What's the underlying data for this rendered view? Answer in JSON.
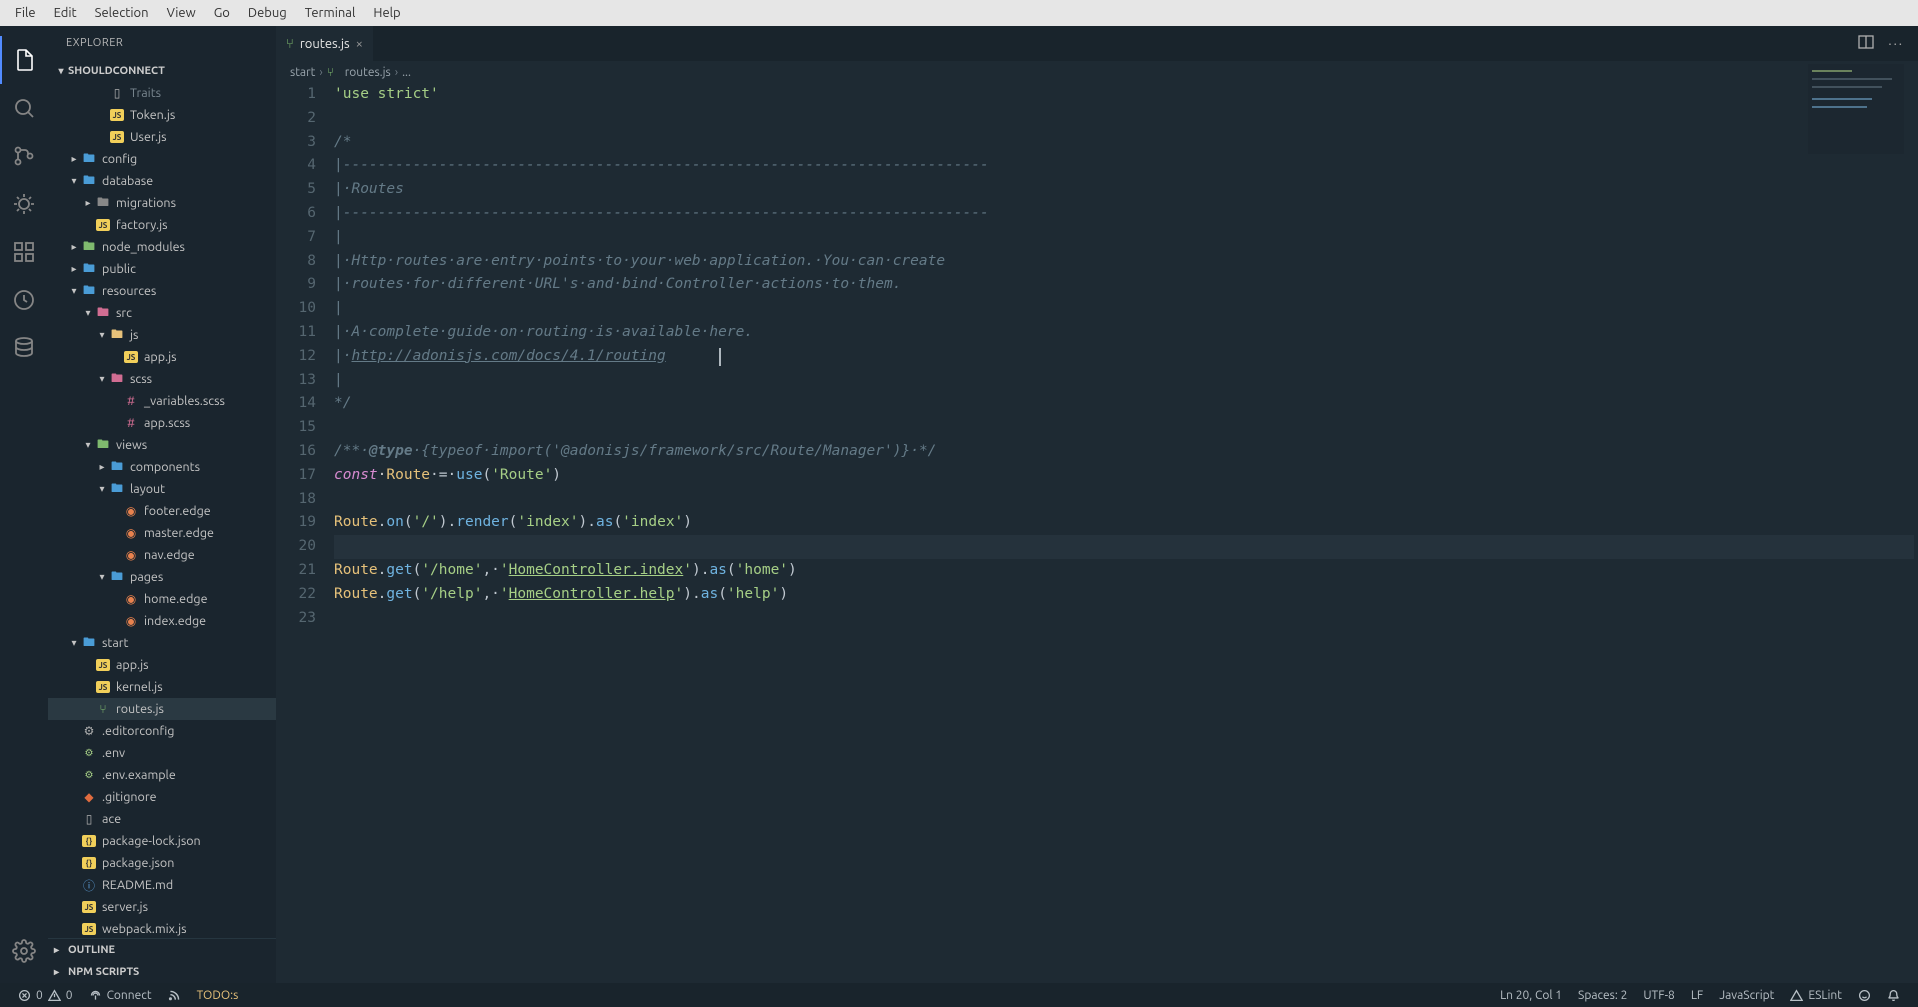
{
  "menubar": [
    "File",
    "Edit",
    "Selection",
    "View",
    "Go",
    "Debug",
    "Terminal",
    "Help"
  ],
  "activitybar": {
    "items": [
      {
        "name": "explorer-icon"
      },
      {
        "name": "search-icon"
      },
      {
        "name": "source-control-icon"
      },
      {
        "name": "debug-icon"
      },
      {
        "name": "extensions-icon"
      },
      {
        "name": "clock-icon"
      },
      {
        "name": "database-icon"
      }
    ],
    "bottom": {
      "name": "settings-gear-icon"
    }
  },
  "sidebar": {
    "header": "EXPLORER",
    "project": "SHOULDCONNECT",
    "tree": [
      {
        "indent": 3,
        "type": "file",
        "icon": "plain",
        "name": "Traits",
        "dim": true
      },
      {
        "indent": 3,
        "type": "file",
        "icon": "js",
        "name": "Token.js"
      },
      {
        "indent": 3,
        "type": "file",
        "icon": "js",
        "name": "User.js"
      },
      {
        "indent": 1,
        "type": "folder-closed",
        "icon": "folder",
        "name": "config"
      },
      {
        "indent": 1,
        "type": "folder-open",
        "icon": "folder",
        "name": "database"
      },
      {
        "indent": 2,
        "type": "folder-closed",
        "icon": "folder-dim",
        "name": "migrations"
      },
      {
        "indent": 2,
        "type": "file",
        "icon": "js",
        "name": "factory.js"
      },
      {
        "indent": 1,
        "type": "folder-closed",
        "icon": "folder-green",
        "name": "node_modules"
      },
      {
        "indent": 1,
        "type": "folder-closed",
        "icon": "folder",
        "name": "public"
      },
      {
        "indent": 1,
        "type": "folder-open",
        "icon": "folder",
        "name": "resources"
      },
      {
        "indent": 2,
        "type": "folder-open",
        "icon": "folder-pink",
        "name": "src"
      },
      {
        "indent": 3,
        "type": "folder-open",
        "icon": "folder-js",
        "name": "js"
      },
      {
        "indent": 4,
        "type": "file",
        "icon": "js",
        "name": "app.js"
      },
      {
        "indent": 3,
        "type": "folder-open",
        "icon": "folder-pink",
        "name": "scss"
      },
      {
        "indent": 4,
        "type": "file",
        "icon": "scss",
        "name": "_variables.scss"
      },
      {
        "indent": 4,
        "type": "file",
        "icon": "scss",
        "name": "app.scss"
      },
      {
        "indent": 2,
        "type": "folder-open",
        "icon": "folder-green",
        "name": "views"
      },
      {
        "indent": 3,
        "type": "folder-closed",
        "icon": "folder",
        "name": "components"
      },
      {
        "indent": 3,
        "type": "folder-open",
        "icon": "folder",
        "name": "layout"
      },
      {
        "indent": 4,
        "type": "file",
        "icon": "edge",
        "name": "footer.edge"
      },
      {
        "indent": 4,
        "type": "file",
        "icon": "edge",
        "name": "master.edge"
      },
      {
        "indent": 4,
        "type": "file",
        "icon": "edge",
        "name": "nav.edge"
      },
      {
        "indent": 3,
        "type": "folder-open",
        "icon": "folder",
        "name": "pages"
      },
      {
        "indent": 4,
        "type": "file",
        "icon": "edge",
        "name": "home.edge"
      },
      {
        "indent": 4,
        "type": "file",
        "icon": "edge",
        "name": "index.edge"
      },
      {
        "indent": 1,
        "type": "folder-open",
        "icon": "folder",
        "name": "start"
      },
      {
        "indent": 2,
        "type": "file",
        "icon": "js",
        "name": "app.js"
      },
      {
        "indent": 2,
        "type": "file",
        "icon": "js",
        "name": "kernel.js"
      },
      {
        "indent": 2,
        "type": "file",
        "icon": "route",
        "name": "routes.js",
        "selected": true
      },
      {
        "indent": 1,
        "type": "file",
        "icon": "config",
        "name": ".editorconfig"
      },
      {
        "indent": 1,
        "type": "file",
        "icon": "env",
        "name": ".env"
      },
      {
        "indent": 1,
        "type": "file",
        "icon": "env",
        "name": ".env.example"
      },
      {
        "indent": 1,
        "type": "file",
        "icon": "git",
        "name": ".gitignore"
      },
      {
        "indent": 1,
        "type": "file",
        "icon": "plain",
        "name": "ace"
      },
      {
        "indent": 1,
        "type": "file",
        "icon": "json",
        "name": "package-lock.json"
      },
      {
        "indent": 1,
        "type": "file",
        "icon": "json",
        "name": "package.json"
      },
      {
        "indent": 1,
        "type": "file",
        "icon": "md",
        "name": "README.md"
      },
      {
        "indent": 1,
        "type": "file",
        "icon": "js",
        "name": "server.js"
      },
      {
        "indent": 1,
        "type": "file",
        "icon": "js",
        "name": "webpack.mix.js"
      }
    ],
    "bottom_sections": [
      "OUTLINE",
      "NPM SCRIPTS"
    ]
  },
  "tab": {
    "icon": "route",
    "label": "routes.js"
  },
  "breadcrumbs": [
    "start",
    "routes.js",
    "..."
  ],
  "editor": {
    "highlight_line": 20,
    "lines": 23,
    "code": {
      "l1": "'use strict'",
      "l3": "/*",
      "l4": "|--------------------------------------------------------------------------",
      "l5": "|·Routes",
      "l6": "|--------------------------------------------------------------------------",
      "l7": "|",
      "l8": "|·Http·routes·are·entry·points·to·your·web·application.·You·can·create",
      "l9": "|·routes·for·different·URL's·and·bind·Controller·actions·to·them.",
      "l10": "|",
      "l11": "|·A·complete·guide·on·routing·is·available·here.",
      "l12_pre": "|·",
      "l12_link": "http://adonisjs.com/docs/4.1/routing",
      "l13": "|",
      "l14": "*/",
      "l16_pre": "/**·",
      "l16_tag": "@type",
      "l16_mid": "·{typeof·",
      "l16_imp": "import",
      "l16_paren": "(",
      "l16_str": "'@adonisjs/framework/src/Route/Manager'",
      "l16_close": ")}",
      "l16_end": "·*/",
      "l17_const": "const",
      "l17_sp": "·",
      "l17_route": "Route",
      "l17_eq": "·=·",
      "l17_use": "use",
      "l17_p1": "(",
      "l17_str": "'Route'",
      "l17_p2": ")",
      "l19_route": "Route",
      "l19_d1": ".",
      "l19_on": "on",
      "l19_p1": "(",
      "l19_s1": "'/'",
      "l19_p2": ").",
      "l19_render": "render",
      "l19_p3": "(",
      "l19_s2": "'index'",
      "l19_p4": ").",
      "l19_as": "as",
      "l19_p5": "(",
      "l19_s3": "'index'",
      "l19_p6": ")",
      "l21_route": "Route",
      "l21_d1": ".",
      "l21_get": "get",
      "l21_p1": "(",
      "l21_s1": "'/home'",
      "l21_c1": ",·",
      "l21_s2a": "'",
      "l21_s2b": "HomeController.index",
      "l21_s2c": "'",
      "l21_p2": ").",
      "l21_as": "as",
      "l21_p3": "(",
      "l21_s3": "'home'",
      "l21_p4": ")",
      "l22_route": "Route",
      "l22_d1": ".",
      "l22_get": "get",
      "l22_p1": "(",
      "l22_s1": "'/help'",
      "l22_c1": ",·",
      "l22_s2a": "'",
      "l22_s2b": "HomeController.help",
      "l22_s2c": "'",
      "l22_p2": ").",
      "l22_as": "as",
      "l22_p3": "(",
      "l22_s3": "'help'",
      "l22_p4": ")"
    }
  },
  "statusbar": {
    "errors": "0",
    "warnings": "0",
    "connect": "Connect",
    "rss": "",
    "todos": "TODO:s",
    "cursor": "Ln 20, Col 1",
    "spaces": "Spaces: 2",
    "encoding": "UTF-8",
    "eol": "LF",
    "language": "JavaScript",
    "eslint": "ESLint",
    "feedback": ""
  }
}
